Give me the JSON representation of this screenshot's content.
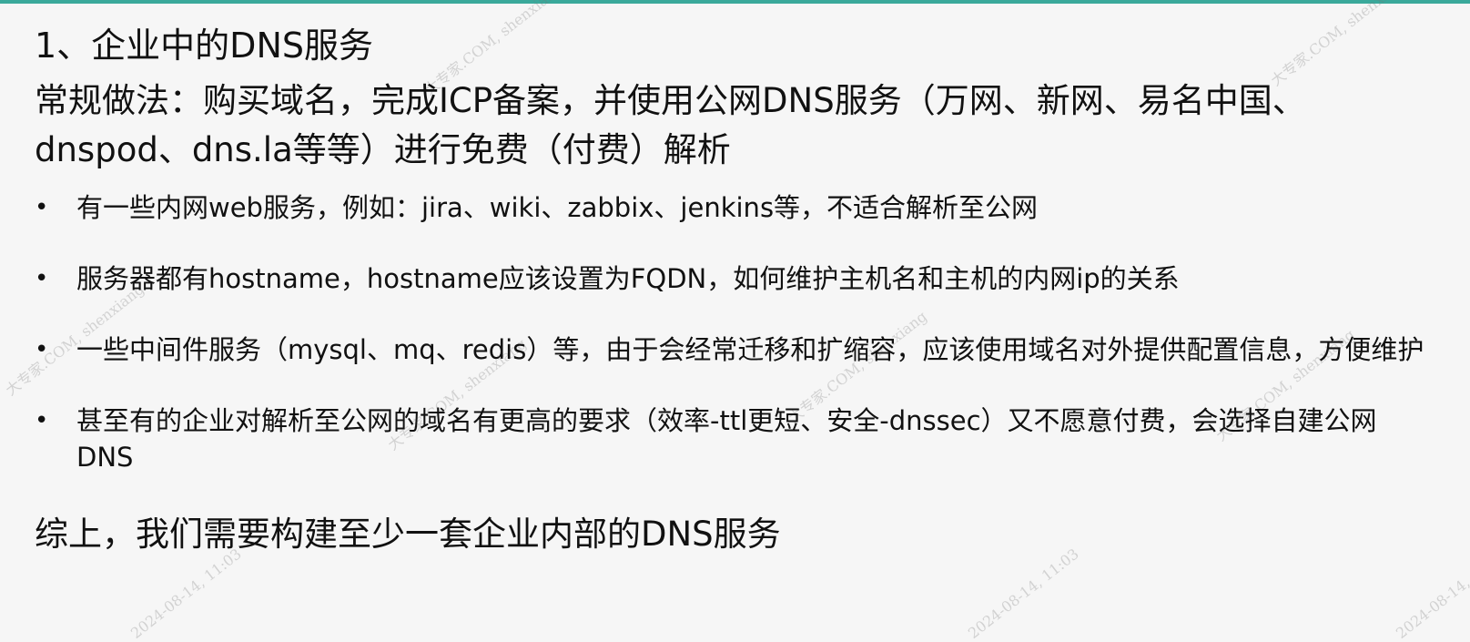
{
  "slide": {
    "title": "1、企业中的DNS服务",
    "intro": "常规做法：购买域名，完成ICP备案，并使用公网DNS服务（万网、新网、易名中国、dnspod、dns.la等等）进行免费（付费）解析",
    "bullet_symbol": "•",
    "bullets": [
      {
        "text": "有一些内网web服务，例如：jira、wiki、zabbix、jenkins等，不适合解析至公网"
      },
      {
        "text": "服务器都有hostname，hostname应该设置为FQDN，如何维护主机名和主机的内网ip的关系"
      },
      {
        "text": "一些中间件服务（mysql、mq、redis）等，由于会经常迁移和扩缩容，应该使用域名对外提供配置信息，方便维护"
      },
      {
        "text": "甚至有的企业对解析至公网的域名有更高的要求（效率-ttl更短、安全-dnssec）又不愿意付费，会选择自建公网DNS"
      }
    ],
    "summary": "综上，我们需要构建至少一套企业内部的DNS服务"
  },
  "watermark": {
    "text_a": "大专家.COM, shenxiang",
    "text_b": "2024-08-14, 11:03"
  },
  "colors": {
    "accent_bar": "#3aa99b",
    "background": "#f6f6f6"
  }
}
